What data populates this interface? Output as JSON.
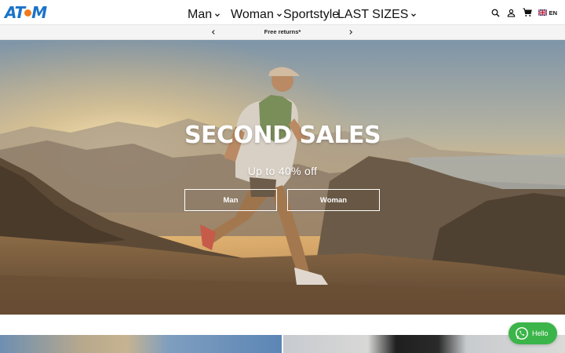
{
  "header": {
    "logo_text": "ATOM",
    "nav": [
      {
        "label": "Man",
        "has_dropdown": true
      },
      {
        "label": "Woman",
        "has_dropdown": true
      },
      {
        "label": "Sportstyle",
        "has_dropdown": false
      },
      {
        "label": "LAST SIZES",
        "has_dropdown": true
      }
    ],
    "icons": [
      "search-icon",
      "account-icon",
      "cart-icon"
    ],
    "language": "EN"
  },
  "promo": {
    "text": "Free returns*"
  },
  "hero": {
    "title": "SECOND SALES",
    "subtitle": "Up to 40% off",
    "buttons": [
      "Man",
      "Woman"
    ]
  },
  "chat": {
    "label": "Hello"
  },
  "colors": {
    "brand_blue": "#1a73c9",
    "brand_orange": "#f07a1e",
    "whatsapp_green": "#3bb549"
  }
}
